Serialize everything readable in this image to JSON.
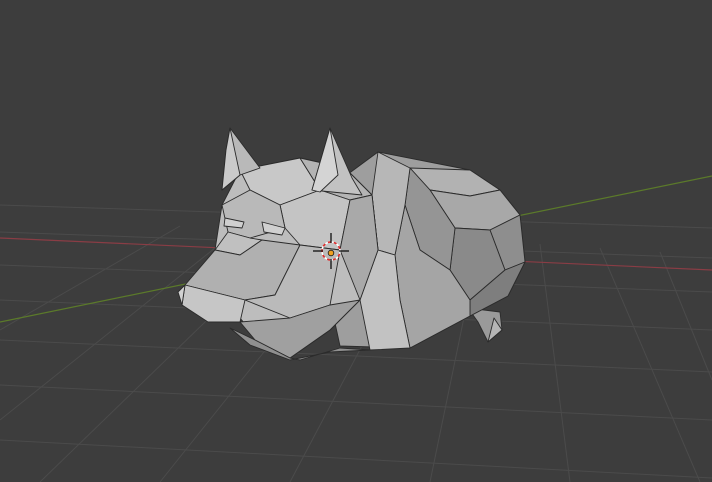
{
  "app": {
    "editor": "3D Viewport",
    "object_name": "",
    "shading": "solid",
    "mode": "edit-wireframe-overlay"
  },
  "colors": {
    "background": "#3d3d3d",
    "grid_line": "#4a4a4a",
    "x_axis": "#8a3d45",
    "y_axis": "#5b7a2a",
    "mesh_light": "#bdbdbd",
    "mesh_mid": "#9c9c9c",
    "mesh_dark": "#7e7e7e",
    "mesh_edge": "#2b2b2b",
    "cursor_red": "#e02c2c",
    "cursor_white": "#ffffff",
    "origin_dot": "#f0a020"
  },
  "icons": {
    "3d_cursor": "3d-cursor-icon",
    "object_origin": "origin-dot-icon"
  }
}
